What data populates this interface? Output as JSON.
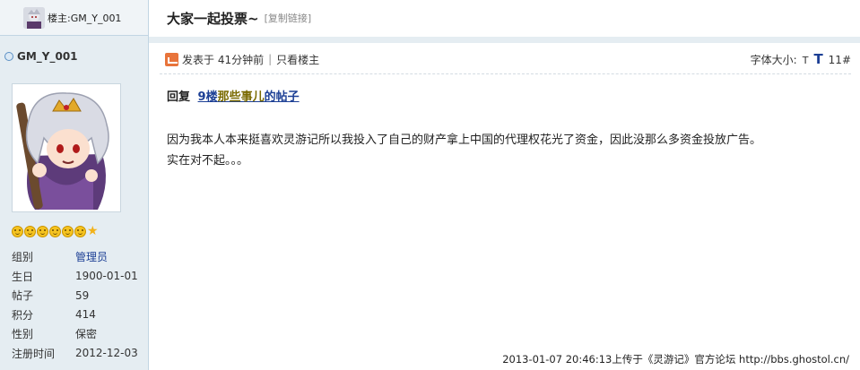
{
  "sidebar": {
    "author_label": "楼主:GM_Y_001",
    "username": "GM_Y_001",
    "rank_icons": [
      "smile-icon",
      "smile-icon",
      "smile-icon",
      "smile-icon",
      "smile-icon",
      "smile-icon",
      "star-icon"
    ],
    "profile": [
      {
        "key": "组别",
        "value": "管理员"
      },
      {
        "key": "生日",
        "value": "1900-01-01"
      },
      {
        "key": "帖子",
        "value": "59"
      },
      {
        "key": "积分",
        "value": "414"
      },
      {
        "key": "性别",
        "value": "保密"
      },
      {
        "key": "注册时间",
        "value": "2012-12-03"
      }
    ]
  },
  "thread": {
    "title": "大家一起投票~",
    "copy_link": "[复制链接]"
  },
  "post": {
    "posted": "发表于 41分钟前",
    "only_author": "只看楼主",
    "font_label": "字体大小:",
    "font_small": "T",
    "font_large": "T",
    "floor": "11#",
    "reply_prefix": "回复",
    "reply_link_a": "9楼",
    "reply_link_b": "那些事儿",
    "reply_link_c": "的帖子",
    "body_line1": "因为我本人本来挺喜欢灵游记所以我投入了自己的财产拿上中国的代理权花光了资金，因此没那么多资金投放广告。",
    "body_line2": "实在对不起。。。"
  },
  "footer": "2013-01-07 20:46:13上传于《灵游记》官方论坛 http://bbs.ghostol.cn/"
}
